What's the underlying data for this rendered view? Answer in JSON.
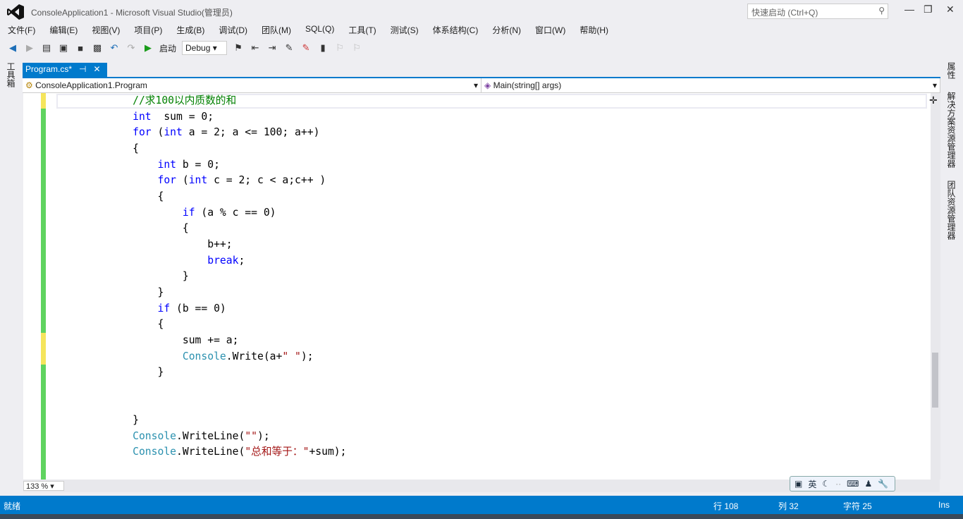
{
  "window": {
    "title": "ConsoleApplication1 - Microsoft Visual Studio(管理员)",
    "quick_launch": "快速启动 (Ctrl+Q)"
  },
  "menu": [
    "文件(F)",
    "编辑(E)",
    "视图(V)",
    "项目(P)",
    "生成(B)",
    "调试(D)",
    "团队(M)",
    "SQL(Q)",
    "工具(T)",
    "测试(S)",
    "体系结构(C)",
    "分析(N)",
    "窗口(W)",
    "帮助(H)"
  ],
  "toolbar": {
    "start_label": "启动",
    "config": "Debug"
  },
  "side": {
    "left": "工具箱",
    "right": [
      "属性",
      "解决方案资源管理器",
      "团队资源管理器"
    ]
  },
  "tab": {
    "label": "Program.cs*"
  },
  "nav": {
    "class": "ConsoleApplication1.Program",
    "member": "Main(string[] args)"
  },
  "code": [
    [
      [
        12,
        "cm",
        "//求100以内质数的和"
      ]
    ],
    [
      [
        12,
        "kw",
        "int"
      ],
      [
        0,
        "",
        "  sum = 0;"
      ]
    ],
    [
      [
        12,
        "kw",
        "for"
      ],
      [
        0,
        "",
        " ("
      ],
      [
        0,
        "kw",
        "int"
      ],
      [
        0,
        "",
        " a = 2; a <= 100; a++)"
      ]
    ],
    [
      [
        12,
        "",
        "{"
      ]
    ],
    [
      [
        16,
        "kw",
        "int"
      ],
      [
        0,
        "",
        " b = 0;"
      ]
    ],
    [
      [
        16,
        "kw",
        "for"
      ],
      [
        0,
        "",
        " ("
      ],
      [
        0,
        "kw",
        "int"
      ],
      [
        0,
        "",
        " c = 2; c < a;c++ )"
      ]
    ],
    [
      [
        16,
        "",
        "{"
      ]
    ],
    [
      [
        20,
        "kw",
        "if"
      ],
      [
        0,
        "",
        " (a % c == 0)"
      ]
    ],
    [
      [
        20,
        "",
        "{"
      ]
    ],
    [
      [
        24,
        "",
        "b++;"
      ]
    ],
    [
      [
        24,
        "kw",
        "break"
      ],
      [
        0,
        "",
        ";"
      ]
    ],
    [
      [
        20,
        "",
        "}"
      ]
    ],
    [
      [
        16,
        "",
        "}"
      ]
    ],
    [
      [
        16,
        "kw",
        "if"
      ],
      [
        0,
        "",
        " (b == 0)"
      ]
    ],
    [
      [
        16,
        "",
        "{"
      ]
    ],
    [
      [
        20,
        "",
        "sum += a;"
      ]
    ],
    [
      [
        20,
        "ty",
        "Console"
      ],
      [
        0,
        "",
        ".Write(a+"
      ],
      [
        0,
        "st",
        "\" \""
      ],
      [
        0,
        "",
        ");"
      ]
    ],
    [
      [
        16,
        "",
        "}"
      ]
    ],
    [],
    [],
    [
      [
        12,
        "",
        "}"
      ]
    ],
    [
      [
        12,
        "ty",
        "Console"
      ],
      [
        0,
        "",
        ".WriteLine("
      ],
      [
        0,
        "st",
        "\"\""
      ],
      [
        0,
        "",
        ");"
      ]
    ],
    [
      [
        12,
        "ty",
        "Console"
      ],
      [
        0,
        "",
        ".WriteLine("
      ],
      [
        0,
        "st",
        "\"总和等于：\""
      ],
      [
        0,
        "",
        "+sum);"
      ]
    ]
  ],
  "editor": {
    "zoom": "133 %"
  },
  "ime": {
    "lang": "英"
  },
  "status": {
    "ready": "就绪",
    "line": "行 108",
    "col": "列 32",
    "char": "字符 25",
    "mode": "Ins"
  }
}
